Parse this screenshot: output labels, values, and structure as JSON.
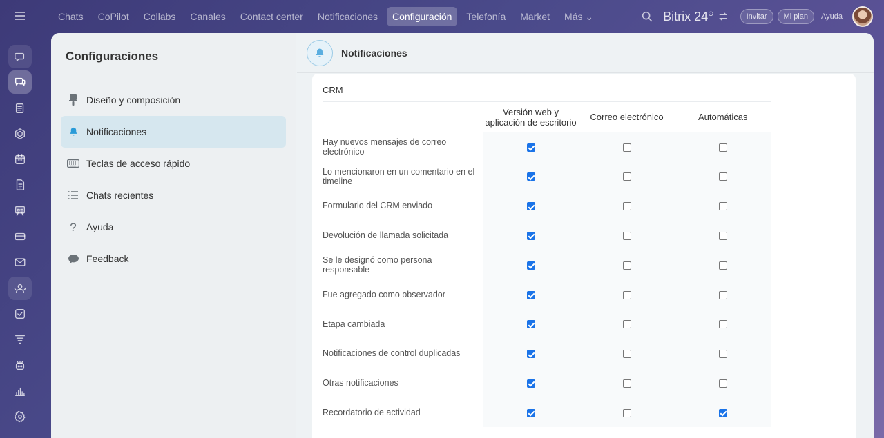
{
  "topbar": {
    "tabs": [
      {
        "label": "Chats",
        "active": false
      },
      {
        "label": "CoPilot",
        "active": false
      },
      {
        "label": "Collabs",
        "active": false
      },
      {
        "label": "Canales",
        "active": false
      },
      {
        "label": "Contact center",
        "active": false
      },
      {
        "label": "Notificaciones",
        "active": false
      },
      {
        "label": "Configuración",
        "active": true
      },
      {
        "label": "Telefonía",
        "active": false
      },
      {
        "label": "Market",
        "active": false
      },
      {
        "label": "Más ⌄",
        "active": false
      }
    ],
    "brand": "Bitrix 24",
    "brand_mark": "⊙",
    "invite": "Invitar",
    "plan": "Mi plan",
    "help": "Ayuda"
  },
  "rail": {
    "icons": [
      "chat-bubble-icon",
      "chats-icon",
      "feed-icon",
      "hexagon-icon",
      "calendar-icon",
      "document-icon",
      "board-icon",
      "card-icon",
      "mail-icon",
      "group-icon",
      "task-icon",
      "filter-icon",
      "robot-icon",
      "chart-icon",
      "settings-icon"
    ]
  },
  "sidebar": {
    "title": "Configuraciones",
    "items": [
      {
        "label": "Diseño y composición",
        "icon": "paint-brush-icon"
      },
      {
        "label": "Notificaciones",
        "icon": "bell-icon"
      },
      {
        "label": "Teclas de acceso rápido",
        "icon": "keyboard-icon"
      },
      {
        "label": "Chats recientes",
        "icon": "list-icon"
      },
      {
        "label": "Ayuda",
        "icon": "question-icon"
      },
      {
        "label": "Feedback",
        "icon": "speech-bubble-icon"
      }
    ]
  },
  "content": {
    "title": "Notificaciones",
    "section": "CRM",
    "columns": [
      "Versión web y aplicación de escritorio",
      "Correo electrónico",
      "Automáticas"
    ],
    "rows": [
      {
        "label": "Hay nuevos mensajes de correo electrónico",
        "web": true,
        "email": false,
        "auto": false
      },
      {
        "label": "Lo mencionaron en un comentario en el timeline",
        "web": true,
        "email": false,
        "auto": false
      },
      {
        "label": "Formulario del CRM enviado",
        "web": true,
        "email": false,
        "auto": false
      },
      {
        "label": "Devolución de llamada solicitada",
        "web": true,
        "email": false,
        "auto": false
      },
      {
        "label": "Se le designó como persona responsable",
        "web": true,
        "email": false,
        "auto": false
      },
      {
        "label": "Fue agregado como observador",
        "web": true,
        "email": false,
        "auto": false
      },
      {
        "label": "Etapa cambiada",
        "web": true,
        "email": false,
        "auto": false
      },
      {
        "label": "Notificaciones de control duplicadas",
        "web": true,
        "email": false,
        "auto": false
      },
      {
        "label": "Otras notificaciones",
        "web": true,
        "email": false,
        "auto": false
      },
      {
        "label": "Recordatorio de actividad",
        "web": true,
        "email": false,
        "auto": true
      }
    ]
  }
}
